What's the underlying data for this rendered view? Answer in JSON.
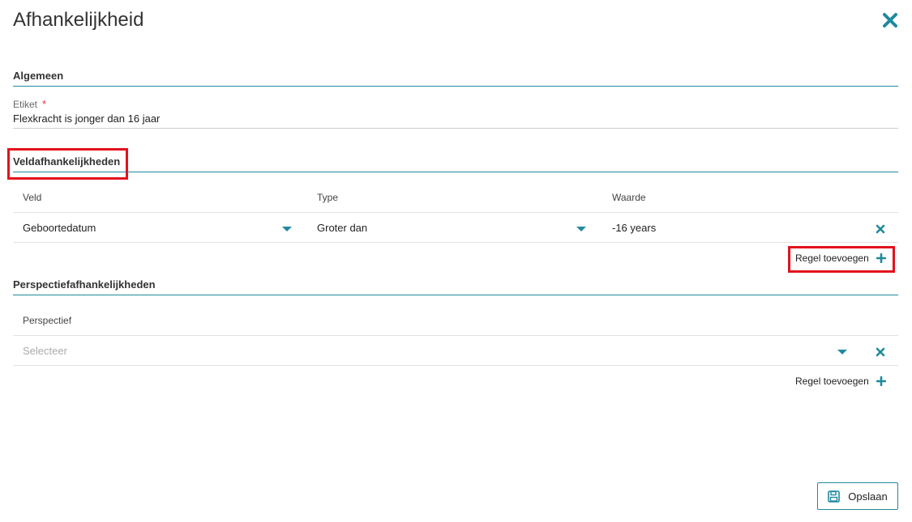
{
  "dialog": {
    "title": "Afhankelijkheid",
    "close_icon": "close-icon"
  },
  "general": {
    "section_title": "Algemeen",
    "label_field": {
      "label": "Etiket",
      "required_marker": "*",
      "value": "Flexkracht is jonger dan 16 jaar"
    }
  },
  "field_dependencies": {
    "section_title": "Veldafhankelijkheden",
    "columns": [
      "Veld",
      "Type",
      "Waarde"
    ],
    "rows": [
      {
        "field": "Geboortedatum",
        "type": "Groter dan",
        "value": "-16 years"
      }
    ],
    "add_row_label": "Regel toevoegen"
  },
  "perspective_dependencies": {
    "section_title": "Perspectiefafhankelijkheden",
    "columns": [
      "Perspectief"
    ],
    "rows": [
      {
        "perspective_placeholder": "Selecteer"
      }
    ],
    "add_row_label": "Regel toevoegen"
  },
  "footer": {
    "save_label": "Opslaan",
    "save_icon": "floppy-disk-icon"
  },
  "colors": {
    "accent": "#1f8a9e",
    "highlight": "#e3121c",
    "required": "#e0363b"
  }
}
